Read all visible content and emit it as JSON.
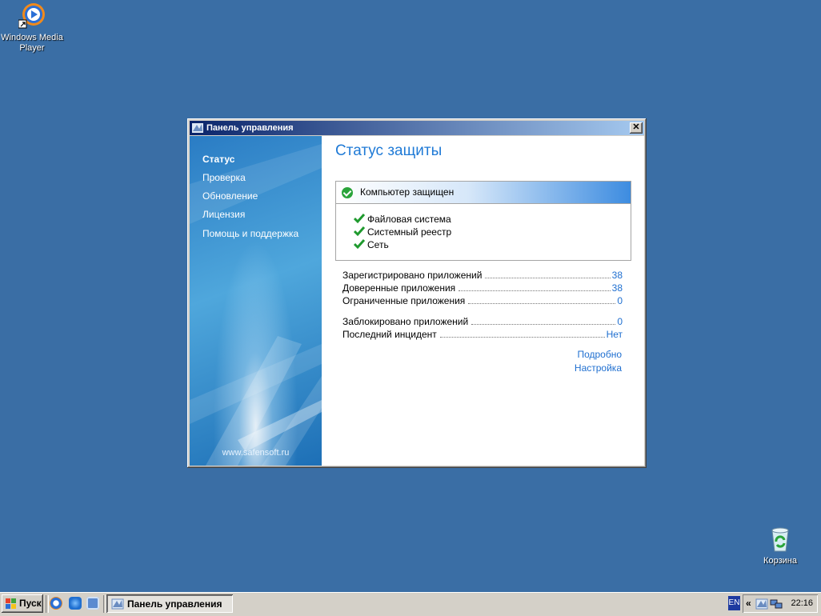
{
  "desktop": {
    "icons": [
      {
        "label_line1": "Windows Media",
        "label_line2": "Player"
      },
      {
        "label": "Корзина"
      }
    ]
  },
  "window": {
    "title": "Панель управления",
    "close_glyph": "✕",
    "nav": [
      {
        "label": "Статус",
        "active": true
      },
      {
        "label": "Проверка"
      },
      {
        "label": "Обновление"
      },
      {
        "label": "Лицензия"
      },
      {
        "label": "Помощь и поддержка"
      }
    ],
    "site": "www.safensoft.ru",
    "heading": "Статус защиты",
    "status": {
      "headline": "Компьютер защищен",
      "items": [
        "Файловая система",
        "Системный реестр",
        "Сеть"
      ]
    },
    "stats": [
      {
        "label": "Зарегистрировано приложений",
        "value": "38"
      },
      {
        "label": "Доверенные приложения",
        "value": "38"
      },
      {
        "label": "Ограниченные приложения",
        "value": "0"
      },
      {
        "label": "Заблокировано приложений",
        "value": "0"
      },
      {
        "label": "Последний инцидент",
        "value": "Нет"
      }
    ],
    "links": {
      "details": "Подробно",
      "settings": "Настройка"
    }
  },
  "taskbar": {
    "start_label": "Пуск",
    "task_label": "Панель управления",
    "lang": "EN",
    "tray_chevron": "«",
    "clock": "22:16"
  },
  "colors": {
    "desktop": "#3a6ea5",
    "accent": "#1f7ad6",
    "ok": "#2aa43a"
  }
}
